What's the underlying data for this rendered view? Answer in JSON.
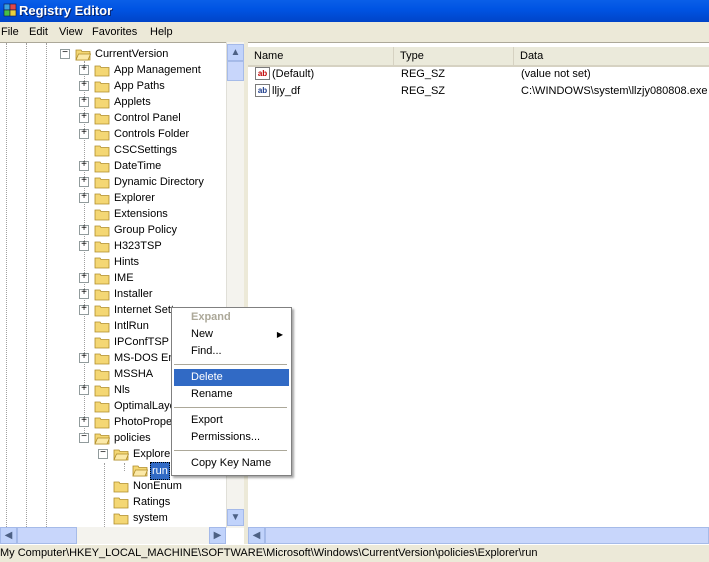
{
  "window": {
    "title": "Registry Editor"
  },
  "menu": [
    "File",
    "Edit",
    "View",
    "Favorites",
    "Help"
  ],
  "tree": {
    "root_label": "CurrentVersion",
    "children": [
      {
        "label": "App Management",
        "expandable": true
      },
      {
        "label": "App Paths",
        "expandable": true
      },
      {
        "label": "Applets",
        "expandable": true
      },
      {
        "label": "Control Panel",
        "expandable": true
      },
      {
        "label": "Controls Folder",
        "expandable": true
      },
      {
        "label": "CSCSettings",
        "expandable": false
      },
      {
        "label": "DateTime",
        "expandable": true
      },
      {
        "label": "Dynamic Directory",
        "expandable": true
      },
      {
        "label": "Explorer",
        "expandable": true
      },
      {
        "label": "Extensions",
        "expandable": false
      },
      {
        "label": "Group Policy",
        "expandable": true
      },
      {
        "label": "H323TSP",
        "expandable": true
      },
      {
        "label": "Hints",
        "expandable": false
      },
      {
        "label": "IME",
        "expandable": true
      },
      {
        "label": "Installer",
        "expandable": true
      },
      {
        "label": "Internet Sett",
        "expandable": true
      },
      {
        "label": "IntlRun",
        "expandable": false
      },
      {
        "label": "IPConfTSP",
        "expandable": false
      },
      {
        "label": "MS-DOS Em",
        "expandable": true
      },
      {
        "label": "MSSHA",
        "expandable": false
      },
      {
        "label": "Nls",
        "expandable": true
      },
      {
        "label": "OptimalLayo",
        "expandable": false
      },
      {
        "label": "PhotoPrope",
        "expandable": true
      },
      {
        "label": "policies",
        "expandable": true
      }
    ],
    "policies_children": {
      "explorer": "Explorer",
      "run": "run",
      "nonenum": "NonEnum",
      "ratings": "Ratings",
      "system": "system"
    }
  },
  "list": {
    "columns": [
      "Name",
      "Type",
      "Data"
    ],
    "rows": [
      {
        "icon": "ab",
        "name": "(Default)",
        "type": "REG_SZ",
        "data": "(value not set)"
      },
      {
        "icon": "ab",
        "name": "lljy_df",
        "type": "REG_SZ",
        "data": "C:\\WINDOWS\\system\\llzjy080808.exe"
      }
    ]
  },
  "context_menu": {
    "expand": "Expand",
    "new": "New",
    "find": "Find...",
    "delete": "Delete",
    "rename": "Rename",
    "export": "Export",
    "permissions": "Permissions...",
    "copy_key_name": "Copy Key Name"
  },
  "status": "My Computer\\HKEY_LOCAL_MACHINE\\SOFTWARE\\Microsoft\\Windows\\CurrentVersion\\policies\\Explorer\\run",
  "icons": {
    "app": "registry-icon",
    "folder": "folder-icon",
    "value": "string-value-icon"
  },
  "colors": {
    "titlebar": "#0054e3",
    "selection": "#316ac5",
    "folder": "#f4d774"
  }
}
